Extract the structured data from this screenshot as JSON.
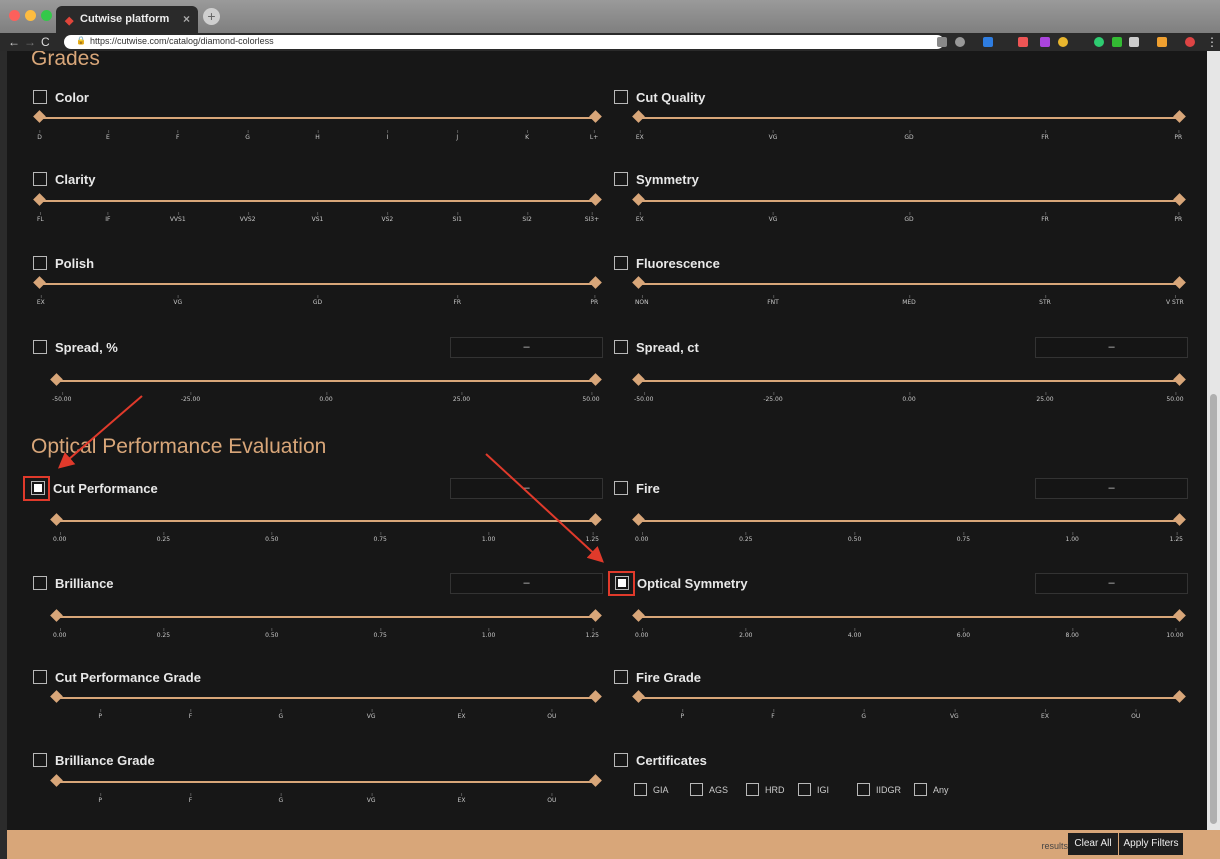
{
  "browser": {
    "tab_title": "Cutwise platform",
    "url": "https://cutwise.com/catalog/diamond-colorless"
  },
  "sections": {
    "grades_title": "Grades",
    "optical_title": "Optical Performance Evaluation"
  },
  "filters": {
    "color": {
      "label": "Color",
      "checked": false,
      "ticks": [
        "D",
        "E",
        "F",
        "G",
        "H",
        "I",
        "J",
        "K",
        "L+"
      ]
    },
    "cut_quality": {
      "label": "Cut Quality",
      "checked": false,
      "ticks": [
        "EX",
        "VG",
        "GD",
        "FR",
        "PR"
      ]
    },
    "clarity": {
      "label": "Clarity",
      "checked": false,
      "ticks": [
        "FL",
        "IF",
        "VVS1",
        "VVS2",
        "VS1",
        "VS2",
        "SI1",
        "SI2",
        "SI3+"
      ]
    },
    "symmetry": {
      "label": "Symmetry",
      "checked": false,
      "ticks": [
        "EX",
        "VG",
        "GD",
        "FR",
        "PR"
      ]
    },
    "polish": {
      "label": "Polish",
      "checked": false,
      "ticks": [
        "EX",
        "VG",
        "GD",
        "FR",
        "PR"
      ]
    },
    "fluorescence": {
      "label": "Fluorescence",
      "checked": false,
      "ticks": [
        "NON",
        "FNT",
        "MED",
        "STR",
        "V STR"
      ]
    },
    "spread_pct": {
      "label": "Spread, %",
      "checked": false,
      "value": "–",
      "ticks": [
        "-50.00",
        "-25.00",
        "0.00",
        "25.00",
        "50.00"
      ]
    },
    "spread_ct": {
      "label": "Spread, ct",
      "checked": false,
      "value": "–",
      "ticks": [
        "-50.00",
        "-25.00",
        "0.00",
        "25.00",
        "50.00"
      ]
    },
    "cut_performance": {
      "label": "Cut Performance",
      "checked": true,
      "value": "–",
      "ticks": [
        "0.00",
        "0.25",
        "0.50",
        "0.75",
        "1.00",
        "1.25"
      ]
    },
    "fire": {
      "label": "Fire",
      "checked": false,
      "value": "–",
      "ticks": [
        "0.00",
        "0.25",
        "0.50",
        "0.75",
        "1.00",
        "1.25"
      ]
    },
    "brilliance": {
      "label": "Brilliance",
      "checked": false,
      "value": "–",
      "ticks": [
        "0.00",
        "0.25",
        "0.50",
        "0.75",
        "1.00",
        "1.25"
      ]
    },
    "optical_symmetry": {
      "label": "Optical Symmetry",
      "checked": true,
      "value": "–",
      "ticks": [
        "0.00",
        "2.00",
        "4.00",
        "6.00",
        "8.00",
        "10.00"
      ]
    },
    "cut_performance_grade": {
      "label": "Cut Performance Grade",
      "checked": false,
      "ticks": [
        "P",
        "F",
        "G",
        "VG",
        "EX",
        "OU"
      ]
    },
    "fire_grade": {
      "label": "Fire Grade",
      "checked": false,
      "ticks": [
        "P",
        "F",
        "G",
        "VG",
        "EX",
        "OU"
      ]
    },
    "brilliance_grade": {
      "label": "Brilliance Grade",
      "checked": false,
      "ticks": [
        "P",
        "F",
        "G",
        "VG",
        "EX",
        "OU"
      ]
    },
    "certificates": {
      "label": "Certificates",
      "checked": false,
      "options": [
        "GIA",
        "AGS",
        "HRD",
        "IGI",
        "IIDGR",
        "Any"
      ]
    }
  },
  "footer": {
    "results_label": "results",
    "clear_label": "Clear All",
    "apply_label": "Apply Filters"
  },
  "colors": {
    "accent": "#d8a679",
    "background": "#171717",
    "highlight": "#e03a2b"
  }
}
